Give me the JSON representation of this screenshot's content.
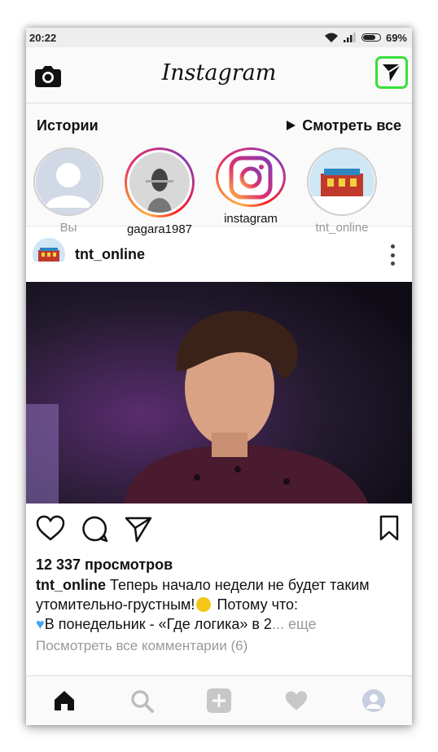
{
  "status_bar": {
    "time": "20:22",
    "battery": "69%",
    "icons": [
      "wifi-icon",
      "signal-icon",
      "battery-icon"
    ]
  },
  "top_bar": {
    "logo": "Instagram",
    "camera_icon": "camera-icon",
    "direct_icon": "paper-plane-icon"
  },
  "stories": {
    "title": "Истории",
    "watch_all": "Смотреть все",
    "items": [
      {
        "label": "Вы",
        "seen": true
      },
      {
        "label": "gagara1987",
        "seen": false
      },
      {
        "label": "instagram",
        "seen": false
      },
      {
        "label": "tnt_online",
        "seen": true
      }
    ]
  },
  "post": {
    "username": "tnt_online",
    "views": "12 337 просмотров",
    "caption_user": "tnt_online",
    "caption_line1": " Теперь начало недели не будет таким",
    "caption_line2": "утомительно-грустным!",
    "caption_line2_tail": " Потому что:",
    "caption_line3": "В понедельник - «Где логика» в 2",
    "caption_ellipsis": "...",
    "caption_more": "еще",
    "comments_link": "Посмотреть все комментарии (6)"
  },
  "bottom_nav": [
    "home-icon",
    "search-icon",
    "add-icon",
    "heart-icon",
    "profile-icon"
  ],
  "colors": {
    "highlight": "#3adf3a",
    "muted": "#999999",
    "divider": "#dbdbdb"
  }
}
